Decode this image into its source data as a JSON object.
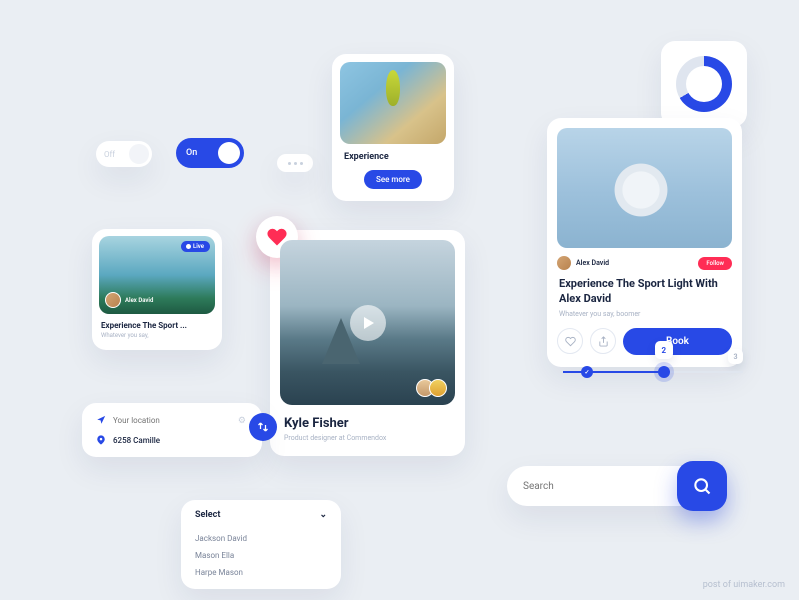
{
  "toggle": {
    "off": "Off",
    "on": "On"
  },
  "experience": {
    "title": "Experience",
    "cta": "See  more"
  },
  "book": {
    "author": "Alex David",
    "follow": "Follow",
    "title": "Experience The Sport Light With Alex David",
    "tagline": "Whatever you say, boomer",
    "cta": "Book"
  },
  "mini": {
    "live": "Live",
    "author": "Alex David",
    "title": "Experience The Sport ...",
    "tagline": "Whatever you say,"
  },
  "profile": {
    "name": "Kyle Fisher",
    "subtitle": "Product designer at Commendox"
  },
  "location": {
    "placeholder": "Your location",
    "address": "6258 Camille"
  },
  "select": {
    "label": "Select",
    "options": [
      "Jackson David",
      "Mason Ella",
      "Harpe Mason"
    ]
  },
  "stepper": {
    "done": "✓",
    "current": "2",
    "next": "3"
  },
  "search": {
    "placeholder": "Search"
  },
  "credit": "post of uimaker.com"
}
